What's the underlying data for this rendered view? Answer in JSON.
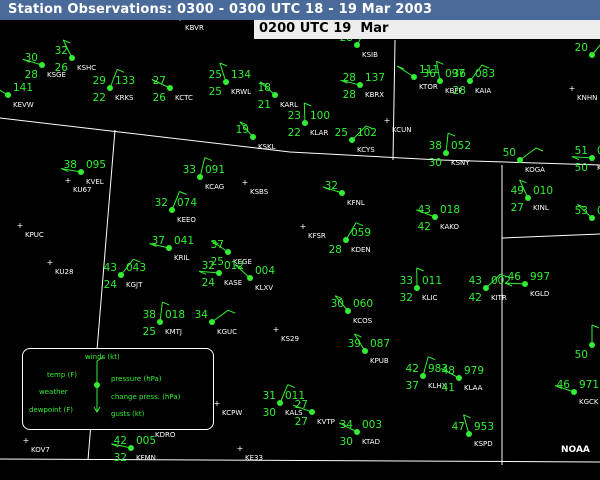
{
  "header": {
    "title": "Station Observations: 0300 - 0300 UTC  18 - 19 Mar 2003",
    "time_label": "0200 UTC 19  Mar"
  },
  "branding": {
    "logo_text": "NOAA"
  },
  "colors": {
    "observation_text": "#33ee33",
    "station_id": "#ffffff",
    "title_bar": "#4a6a9a",
    "background": "#000000"
  },
  "legend": {
    "winds": "winds (kt)",
    "temp": "temp (F)",
    "weather": "weather",
    "dewpoint": "dewpoint (F)",
    "pressure": "pressure (hPa)",
    "change_press": "change press. (hPa)",
    "gusts": "gusts (kt)"
  },
  "stations": [
    {
      "id": "KEVW",
      "t": "",
      "d": "",
      "p": "141"
    },
    {
      "id": "KSGE",
      "t": "30",
      "d": "28",
      "p": ""
    },
    {
      "id": "KSHC",
      "t": "32",
      "d": "26",
      "p": ""
    },
    {
      "id": "KRKS",
      "t": "29",
      "d": "22",
      "p": "133"
    },
    {
      "id": "KBVR",
      "t": "",
      "d": "",
      "p": ""
    },
    {
      "id": "KCTC",
      "t": "27",
      "d": "26",
      "p": ""
    },
    {
      "id": "KRWL",
      "t": "25",
      "d": "25",
      "p": "134"
    },
    {
      "id": "KSIB",
      "t": "28",
      "d": "",
      "p": ""
    },
    {
      "id": "KBRX",
      "t": "28",
      "d": "28",
      "p": "137"
    },
    {
      "id": "KTOR",
      "t": "",
      "d": "",
      "p": "111"
    },
    {
      "id": "KBFF",
      "t": "36",
      "d": "",
      "p": "097"
    },
    {
      "id": "KAIA",
      "t": "36",
      "d": "28",
      "p": "083"
    },
    {
      "id": "KNHN",
      "t": "",
      "d": "",
      "p": ""
    },
    {
      "id": "KARL",
      "t": "18",
      "d": "21",
      "p": ""
    },
    {
      "id": "KLAR",
      "t": "23",
      "d": "22",
      "p": "100"
    },
    {
      "id": "KCYS",
      "t": "25",
      "d": "",
      "p": "102"
    },
    {
      "id": "KCUN",
      "t": "",
      "d": "",
      "p": ""
    },
    {
      "id": "KSKL",
      "t": "19",
      "d": "",
      "p": ""
    },
    {
      "id": "KSNY",
      "t": "38",
      "d": "30",
      "p": "052"
    },
    {
      "id": "KOGA",
      "t": "50",
      "d": "",
      "p": ""
    },
    {
      "id": "KVEL",
      "t": "38",
      "d": "",
      "p": "095"
    },
    {
      "id": "KU67",
      "t": "",
      "d": "",
      "p": ""
    },
    {
      "id": "KCAG",
      "t": "33",
      "d": "",
      "p": "091"
    },
    {
      "id": "KSBS",
      "t": "",
      "d": "",
      "p": ""
    },
    {
      "id": "KFNL",
      "t": "32",
      "d": "",
      "p": ""
    },
    {
      "id": "KINL",
      "t": "49",
      "d": "27",
      "p": "010"
    },
    {
      "id": "KEEO",
      "t": "32",
      "d": "",
      "p": "074"
    },
    {
      "id": "KAKO",
      "t": "43",
      "d": "42",
      "p": "018"
    },
    {
      "id": "KPUC",
      "t": "",
      "d": "",
      "p": ""
    },
    {
      "id": "KFSR",
      "t": "",
      "d": "",
      "p": ""
    },
    {
      "id": "KDEN",
      "t": "",
      "d": "28",
      "p": "059"
    },
    {
      "id": "KRIL",
      "t": "37",
      "d": "",
      "p": "041"
    },
    {
      "id": "KEGE",
      "t": "37",
      "d": "25",
      "p": ""
    },
    {
      "id": "KU28",
      "t": "",
      "d": "",
      "p": ""
    },
    {
      "id": "KGJT",
      "t": "43",
      "d": "24",
      "p": "043"
    },
    {
      "id": "KASE",
      "t": "32",
      "d": "24",
      "p": "012"
    },
    {
      "id": "KLXV",
      "t": "",
      "d": "",
      "p": "004"
    },
    {
      "id": "KLIC",
      "t": "33",
      "d": "32",
      "p": "011"
    },
    {
      "id": "KITR",
      "t": "43",
      "d": "42",
      "p": "002"
    },
    {
      "id": "KGLD",
      "t": "46",
      "d": "",
      "p": "997"
    },
    {
      "id": "KCOS",
      "t": "30",
      "d": "",
      "p": "060"
    },
    {
      "id": "KMTJ",
      "t": "38",
      "d": "25",
      "p": "018"
    },
    {
      "id": "KGUC",
      "t": "34",
      "d": "",
      "p": ""
    },
    {
      "id": "KS29",
      "t": "",
      "d": "",
      "p": ""
    },
    {
      "id": "KPUB",
      "t": "39",
      "d": "",
      "p": "087"
    },
    {
      "id": "KLHX",
      "t": "42",
      "d": "37",
      "p": "983"
    },
    {
      "id": "KLAA",
      "t": "48",
      "d": "41",
      "p": "979"
    },
    {
      "id": "KGCK",
      "t": "46",
      "d": "",
      "p": "971"
    },
    {
      "id": "KCPW",
      "t": "",
      "d": "",
      "p": ""
    },
    {
      "id": "KALS",
      "t": "31",
      "d": "30",
      "p": "011"
    },
    {
      "id": "KVTP",
      "t": "27",
      "d": "27",
      "p": ""
    },
    {
      "id": "KTAD",
      "t": "34",
      "d": "30",
      "p": "003"
    },
    {
      "id": "KSPD",
      "t": "47",
      "d": "",
      "p": "953"
    },
    {
      "id": "KDRO",
      "t": "",
      "d": "",
      "p": ""
    },
    {
      "id": "KFMN",
      "t": "42",
      "d": "32",
      "p": "005"
    },
    {
      "id": "KOV7",
      "t": "",
      "d": "",
      "p": ""
    },
    {
      "id": "KE33",
      "t": "",
      "d": "",
      "p": ""
    },
    {
      "id": "",
      "t": "20",
      "d": "",
      "p": ""
    },
    {
      "id": "KL",
      "t": "51",
      "d": "50",
      "p": "03"
    },
    {
      "id": "",
      "t": "53",
      "d": "",
      "p": "0"
    },
    {
      "id": "",
      "t": "",
      "d": "50",
      "p": ""
    }
  ]
}
